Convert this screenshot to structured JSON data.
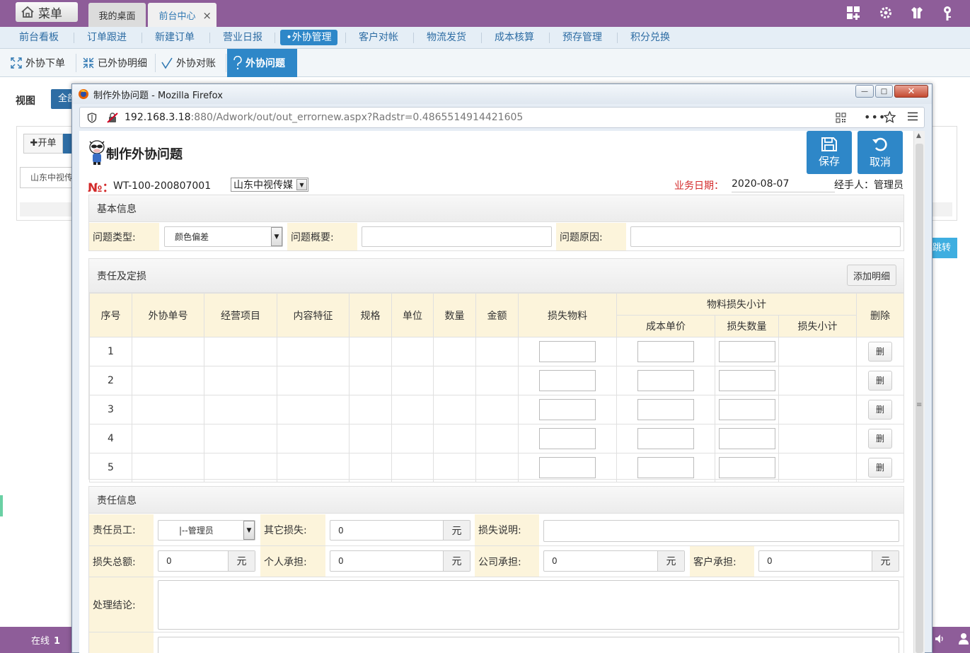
{
  "app": {
    "menu_label": "菜单",
    "tabs": [
      "我的桌面",
      "前台中心"
    ],
    "tab_close": "×"
  },
  "nav_primary": [
    "前台看板",
    "订单跟进",
    "新建订单",
    "营业日报",
    "•外协管理",
    "客户对帐",
    "物流发货",
    "成本核算",
    "预存管理",
    "积分兑换"
  ],
  "nav_secondary": [
    "外协下单",
    "已外协明细",
    "外协对账",
    "外协问题"
  ],
  "background": {
    "view_label": "视图",
    "all_button": "全部",
    "open_button": "✚开单",
    "company_field": "山东中视传媒",
    "jump_button": "跳转",
    "status_text": "在线",
    "status_count": "1"
  },
  "window": {
    "title": "制作外协问题 - Mozilla Firefox",
    "url_host": "192.168.3.18",
    "url_rest": ":880/Adwork/out/out_errornew.aspx?Radstr=0.4865514914421605",
    "minimize": "—",
    "maximize": "□",
    "close": "✕"
  },
  "form": {
    "title": "制作外协问题",
    "save_label": "保存",
    "cancel_label": "取消",
    "no_label": "№：",
    "no_value": "WT-100-200807001",
    "company": "山东中视传媒",
    "date_label": "业务日期：",
    "date_value": "2020-08-07",
    "handler": "经手人：管理员"
  },
  "basic": {
    "title": "基本信息",
    "type_label": "问题类型:",
    "type_value": "颜色偏差",
    "summary_label": "问题概要:",
    "summary_value": "",
    "reason_label": "问题原因:",
    "reason_value": ""
  },
  "duty": {
    "title": "责任及定损",
    "add_button": "添加明细",
    "headers": {
      "seq": "序号",
      "out_no": "外协单号",
      "project": "经营项目",
      "content": "内容特征",
      "spec": "规格",
      "unit": "单位",
      "qty": "数量",
      "amount": "金额",
      "lost_material": "损失物料",
      "subtotal_group": "物料损失小计",
      "cost_price": "成本单价",
      "lost_qty": "损失数量",
      "lost_subtotal": "损失小计",
      "delete": "删除"
    },
    "rows": [
      "1",
      "2",
      "3",
      "4",
      "5"
    ],
    "delete_label": "删"
  },
  "info": {
    "title": "责任信息",
    "staff_label": "责任员工:",
    "staff_value": "|--管理员",
    "other_loss_label": "其它损失:",
    "other_loss_value": "0",
    "loss_desc_label": "损失说明:",
    "loss_desc_value": "",
    "total_loss_label": "损失总额:",
    "total_loss_value": "0",
    "personal_label": "个人承担:",
    "personal_value": "0",
    "company_label": "公司承担:",
    "company_value": "0",
    "customer_label": "客户承担:",
    "customer_value": "0",
    "unit": "元",
    "conclusion_label": "处理结论:",
    "conclusion_value": ""
  }
}
